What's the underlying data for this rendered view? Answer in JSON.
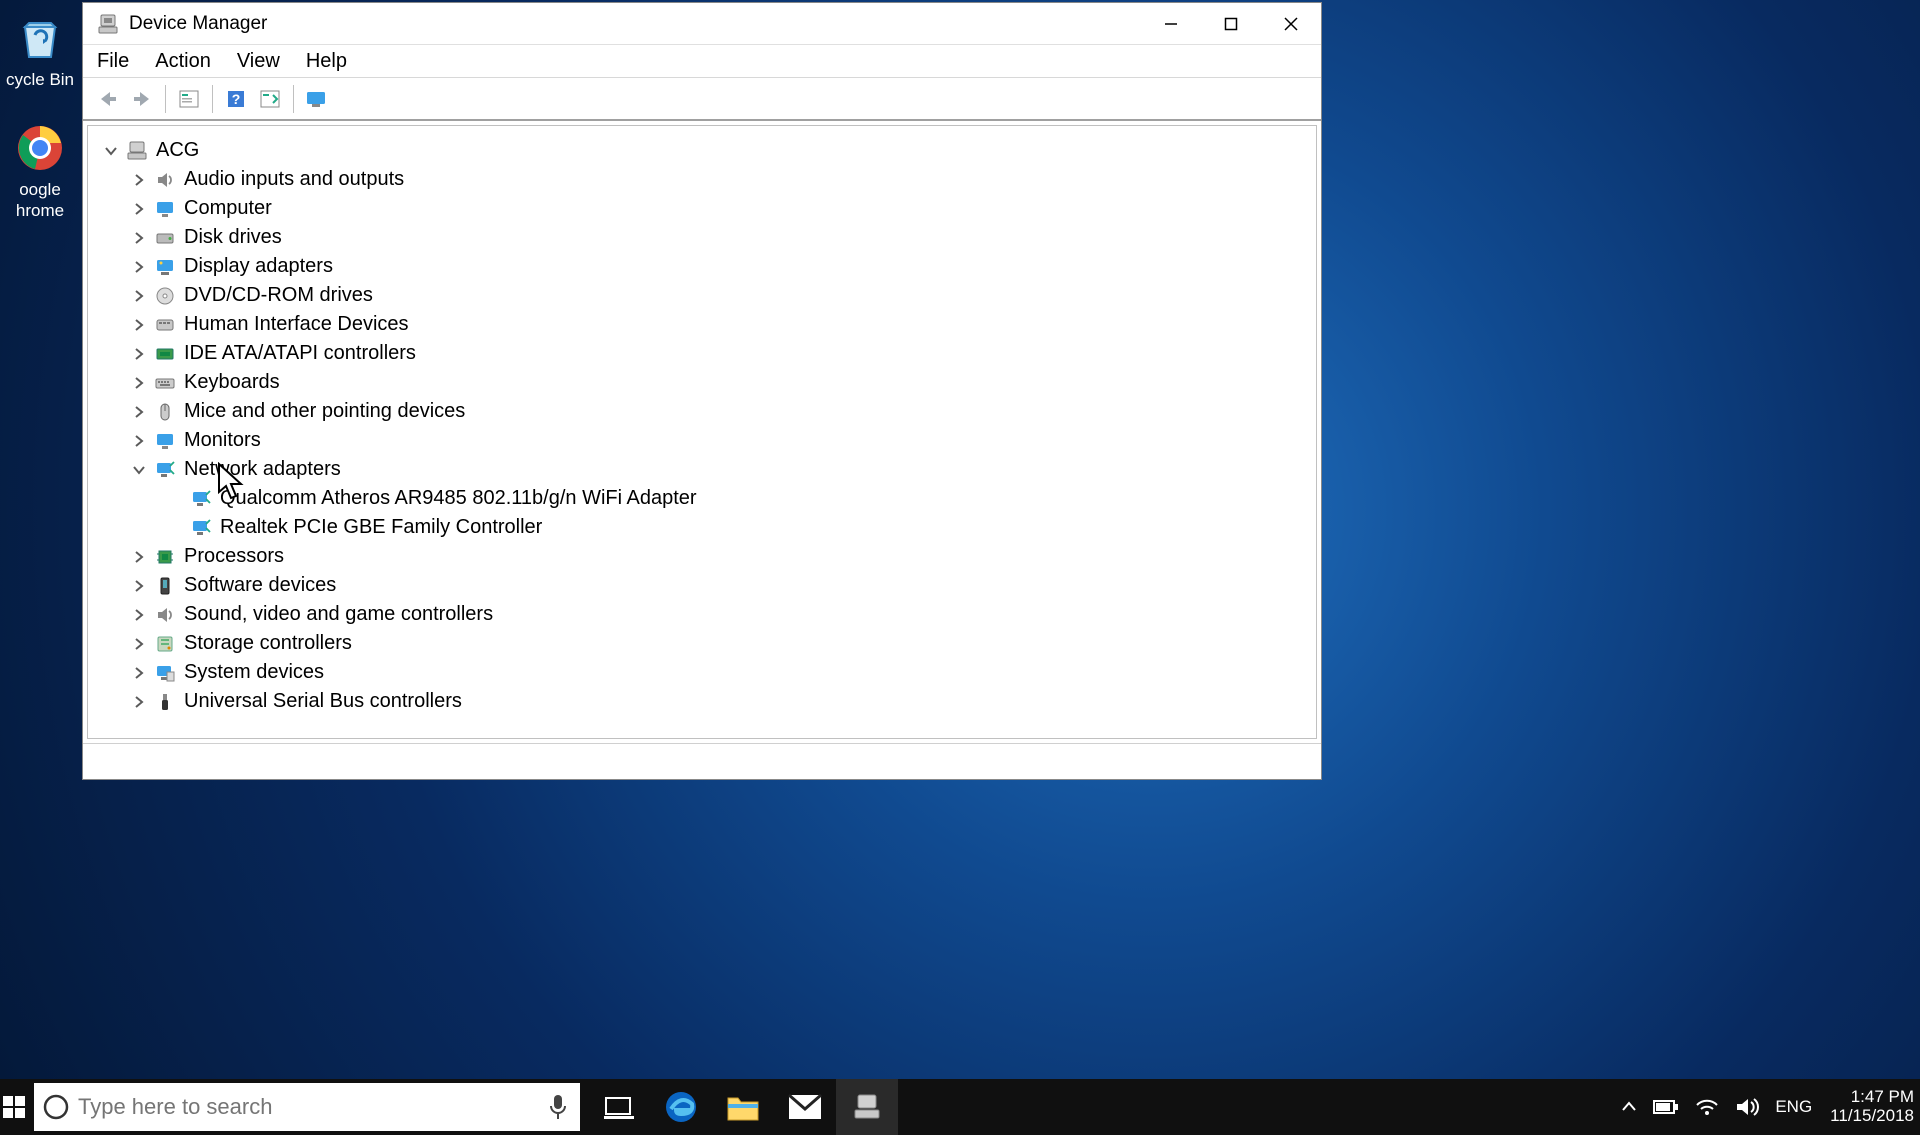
{
  "desktop": {
    "icons": [
      {
        "name": "recycle-bin",
        "label": "cycle Bin"
      },
      {
        "name": "google-chrome",
        "label": "oogle\nhrome"
      }
    ]
  },
  "window": {
    "title": "Device Manager",
    "menu": [
      "File",
      "Action",
      "View",
      "Help"
    ],
    "toolbar": [
      "back",
      "forward",
      "sep",
      "properties",
      "sep",
      "help",
      "scan",
      "sep",
      "show"
    ],
    "root": {
      "label": "ACG",
      "expanded": true
    },
    "categories": [
      {
        "label": "Audio inputs and outputs",
        "icon": "speaker",
        "expanded": false
      },
      {
        "label": "Computer",
        "icon": "monitor",
        "expanded": false
      },
      {
        "label": "Disk drives",
        "icon": "disk",
        "expanded": false
      },
      {
        "label": "Display adapters",
        "icon": "display",
        "expanded": false
      },
      {
        "label": "DVD/CD-ROM drives",
        "icon": "dvd",
        "expanded": false
      },
      {
        "label": "Human Interface Devices",
        "icon": "hid",
        "expanded": false
      },
      {
        "label": "IDE ATA/ATAPI controllers",
        "icon": "ide",
        "expanded": false
      },
      {
        "label": "Keyboards",
        "icon": "keyboard",
        "expanded": false
      },
      {
        "label": "Mice and other pointing devices",
        "icon": "mouse",
        "expanded": false
      },
      {
        "label": "Monitors",
        "icon": "monitor",
        "expanded": false
      },
      {
        "label": "Network adapters",
        "icon": "network",
        "expanded": true,
        "children": [
          {
            "label": "Qualcomm Atheros AR9485 802.11b/g/n WiFi Adapter",
            "icon": "network"
          },
          {
            "label": "Realtek PCIe GBE Family Controller",
            "icon": "network"
          }
        ]
      },
      {
        "label": "Processors",
        "icon": "cpu",
        "expanded": false
      },
      {
        "label": "Software devices",
        "icon": "software",
        "expanded": false
      },
      {
        "label": "Sound, video and game controllers",
        "icon": "speaker",
        "expanded": false
      },
      {
        "label": "Storage controllers",
        "icon": "storage",
        "expanded": false
      },
      {
        "label": "System devices",
        "icon": "system",
        "expanded": false
      },
      {
        "label": "Universal Serial Bus controllers",
        "icon": "usb",
        "expanded": false
      }
    ]
  },
  "taskbar": {
    "search_placeholder": "Type here to search",
    "tray": {
      "lang": "ENG",
      "time": "1:47 PM",
      "date": "11/15/2018"
    }
  }
}
